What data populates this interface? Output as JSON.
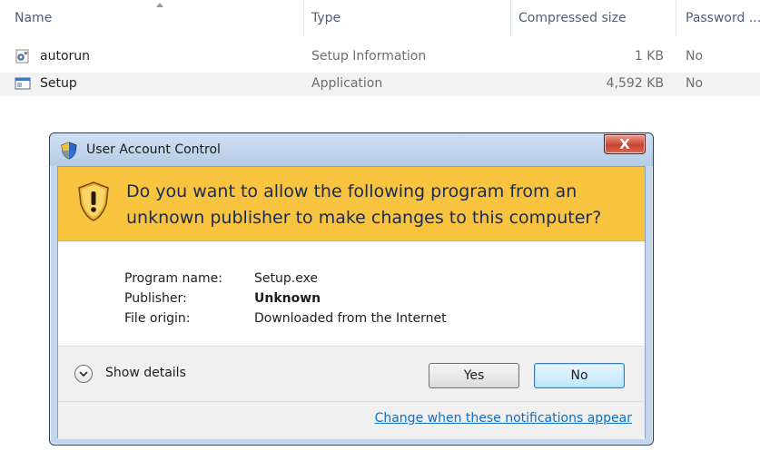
{
  "columns": {
    "name": "Name",
    "type": "Type",
    "size": "Compressed size",
    "password": "Password ..."
  },
  "files": [
    {
      "name": "autorun",
      "type": "Setup Information",
      "size": "1 KB",
      "password": "No",
      "icon": "settings-file-icon"
    },
    {
      "name": "Setup",
      "type": "Application",
      "size": "4,592 KB",
      "password": "No",
      "icon": "application-icon"
    }
  ],
  "dialog": {
    "title": "User Account Control",
    "close_label": "X",
    "question": "Do you want to allow the following program from an unknown publisher to make changes to this computer?",
    "details": [
      {
        "label": "Program name:",
        "value": "Setup.exe"
      },
      {
        "label": "Publisher:",
        "value": "Unknown"
      },
      {
        "label": "File origin:",
        "value": "Downloaded from the Internet"
      }
    ],
    "show_details": "Show details",
    "yes": "Yes",
    "no": "No",
    "change_link": "Change when these notifications appear"
  },
  "colors": {
    "banner": "#f8c43f",
    "link": "#0f6fc6",
    "close": "#c9432e"
  }
}
